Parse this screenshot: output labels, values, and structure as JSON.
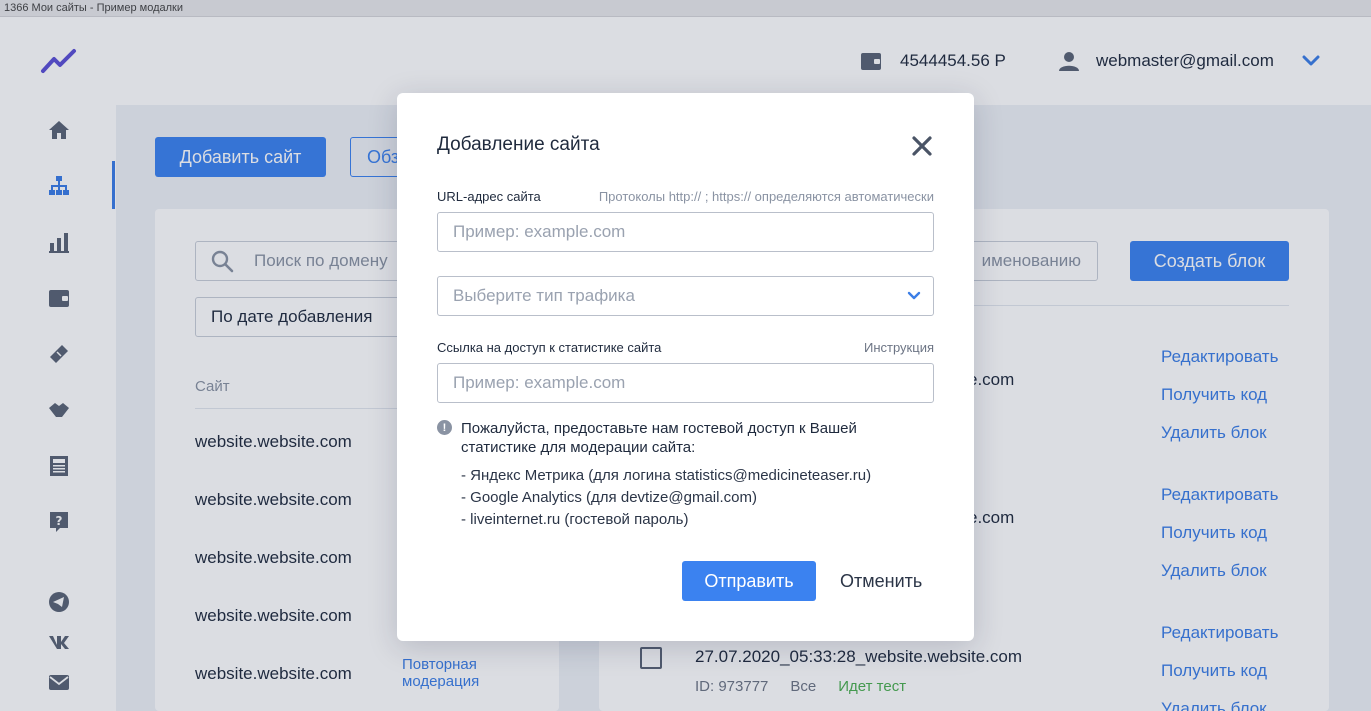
{
  "window": {
    "title": "1366 Мои сайты - Пример модалки"
  },
  "header": {
    "balance": "4544454.56 Р",
    "user_email": "webmaster@gmail.com"
  },
  "sidebar": {
    "items": [
      "home-icon",
      "sitemap-icon",
      "bar-chart-icon",
      "wallet-icon",
      "ticket-icon",
      "handshake-icon",
      "newspaper-icon",
      "help-icon"
    ],
    "social": [
      "telegram-icon",
      "vk-icon",
      "mail-icon"
    ]
  },
  "toolbar": {
    "add_site_label": "Добавить сайт",
    "second_button_label": "Обз"
  },
  "left_panel": {
    "search_placeholder": "Поиск по домену",
    "sort_label": "По дате добавления",
    "column_site": "Сайт",
    "sites": [
      "website.website.com",
      "website.website.com",
      "website.website.com",
      "website.website.com",
      "website.website.com"
    ],
    "remoderation_label": "Повторная модерация"
  },
  "right_panel": {
    "search_placeholder": "именованию",
    "create_block_label": "Создать блок",
    "block_names": [
      "e.com",
      "e.com"
    ],
    "last_block": {
      "name": "27.07.2020_05:33:28_website.website.com",
      "id": "ID: 973777",
      "scope": "Все",
      "status": "Идет тест",
      "status_color": "#4caf50"
    },
    "actions": {
      "edit": "Редактировать",
      "get_code": "Получить код",
      "delete": "Удалить блок"
    }
  },
  "modal": {
    "title": "Добавление сайта",
    "url_label": "URL-адрес сайта",
    "url_hint": "Протоколы http:// ; https:// определяются автоматически",
    "url_placeholder": "Пример: example.com",
    "traffic_placeholder": "Выберите тип трафика",
    "stats_label": "Ссылка на доступ к статистике сайта",
    "stats_hint": "Инструкция",
    "stats_placeholder": "Пример: example.com",
    "info_icon": "!",
    "info_text": "Пожалуйста, предоставьте нам гостевой доступ к Вашей статистике для модерации сайта:",
    "info_items": [
      "- Яндекс Метрика (для логина statistics@medicineteaser.ru)",
      "- Google Analytics (для devtize@gmail.com)",
      "- liveinternet.ru (гостевой пароль)"
    ],
    "submit_label": "Отправить",
    "cancel_label": "Отменить"
  },
  "colors": {
    "accent": "#3b82f0",
    "link": "#3b7ee6",
    "logo": "#5b4fd6"
  }
}
